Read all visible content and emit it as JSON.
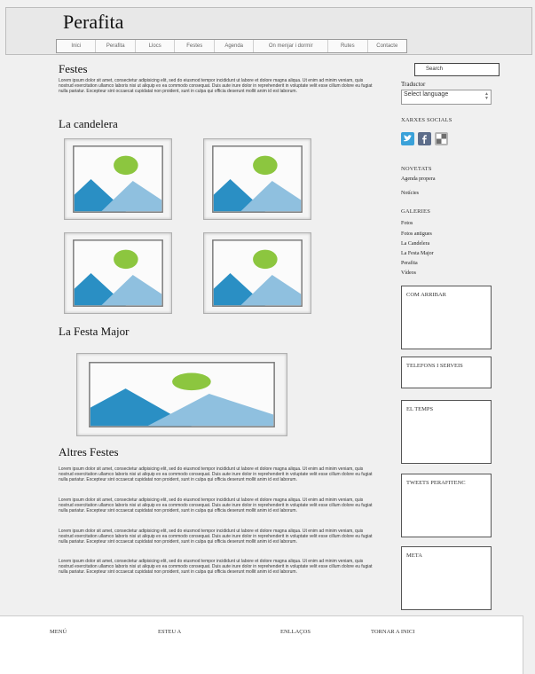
{
  "site": {
    "title": "Perafita"
  },
  "nav": [
    {
      "label": "Inici"
    },
    {
      "label": "Perafita"
    },
    {
      "label": "Llocs"
    },
    {
      "label": "Festes"
    },
    {
      "label": "Agenda"
    },
    {
      "label": "On menjar i dormir"
    },
    {
      "label": "Rutes"
    },
    {
      "label": "Contacte"
    }
  ],
  "main": {
    "title": "Festes",
    "intro": "Lorem ipsum dolor sit amet, consectetur adipisicing elit, sed do eiusmod tempor incididunt ut labore et dolore magna aliqua. Ut enim ad minim veniam, quis nostrud exercitation ullamco laboris nisi ut aliquip ex ea commodo consequat. Duis aute irure dolor in reprehenderit in voluptate velit esse cillum dolore eu fugiat nulla pariatur. Excepteur sint occaecat cupidatat non proident, sunt in culpa qui officia deserunt mollit anim id est laborum.",
    "section1": "La candelera",
    "section2": "La Festa Major",
    "section3": "Altres Festes",
    "paragraphs": [
      "Lorem ipsum dolor sit amet, consectetur adipisicing elit, sed do eiusmod tempor incididunt ut labore et dolore magna aliqua. Ut enim ad minim veniam, quis nostrud exercitation ullamco laboris nisi ut aliquip ex ea commodo consequat. Duis aute irure dolor in reprehenderit in voluptate velit esse cillum dolore eu fugiat nulla pariatur. Excepteur sint occaecat cupidatat non proident, sunt in culpa qui officia deserunt mollit anim id est laborum.",
      "Lorem ipsum dolor sit amet, consectetur adipisicing elit, sed do eiusmod tempor incididunt ut labore et dolore magna aliqua. Ut enim ad minim veniam, quis nostrud exercitation ullamco laboris nisi ut aliquip ex ea commodo consequat. Duis aute irure dolor in reprehenderit in voluptate velit esse cillum dolore eu fugiat nulla pariatur. Excepteur sint occaecat cupidatat non proident, sunt in culpa qui officia deserunt mollit anim id est laborum.",
      "Lorem ipsum dolor sit amet, consectetur adipisicing elit, sed do eiusmod tempor incididunt ut labore et dolore magna aliqua. Ut enim ad minim veniam, quis nostrud exercitation ullamco laboris nisi ut aliquip ex ea commodo consequat. Duis aute irure dolor in reprehenderit in voluptate velit esse cillum dolore eu fugiat nulla pariatur. Excepteur sint occaecat cupidatat non proident, sunt in culpa qui officia deserunt mollit anim id est laborum.",
      "Lorem ipsum dolor sit amet, consectetur adipisicing elit, sed do eiusmod tempor incididunt ut labore et dolore magna aliqua. Ut enim ad minim veniam, quis nostrud exercitation ullamco laboris nisi ut aliquip ex ea commodo consequat. Duis aute irure dolor in reprehenderit in voluptate velit esse cillum dolore eu fugiat nulla pariatur. Excepteur sint occaecat cupidatat non proident, sunt in culpa qui officia deserunt mollit anim id est laborum."
    ]
  },
  "sidebar": {
    "search_placeholder": "Search",
    "translator_label": "Traductor",
    "language_select": "Select language",
    "social_heading": "XARXES SOCIALS",
    "social_icons": [
      "twitter-icon",
      "facebook-icon",
      "delicious-icon"
    ],
    "news_heading": "NOVETATS",
    "news_links": [
      "Agenda propera",
      "Notícies"
    ],
    "galleries_heading": "GALERIES",
    "gallery_links": [
      "Fotos",
      "Fotos antigues",
      "La Candelera",
      "La Festa Major",
      "Perafita",
      "Vídeos"
    ],
    "widgets": [
      "COM ARRIBAR",
      "TELEFONS I SERVEIS",
      "EL TEMPS",
      "TWEETS PERAFITENC",
      "META"
    ]
  },
  "footer": {
    "items": [
      "MENÚ",
      "ESTEU A",
      "ENLLAÇOS",
      "TORNAR A INICI"
    ]
  },
  "colors": {
    "image_blue_dark": "#2a8fc4",
    "image_blue_light": "#8fc0df",
    "image_green": "#8cc63f",
    "twitter": "#3aa1d9",
    "facebook": "#3b5998"
  }
}
